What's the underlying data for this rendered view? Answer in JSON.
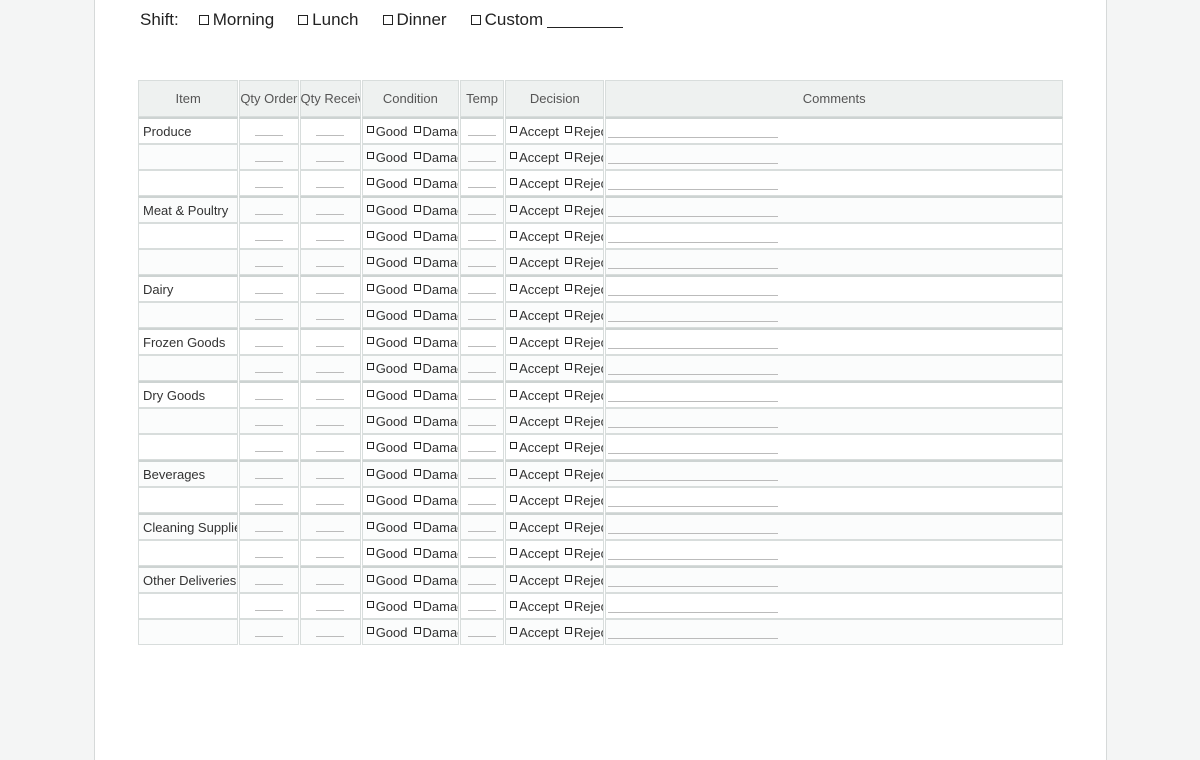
{
  "shift": {
    "label": "Shift:",
    "options": [
      "Morning",
      "Lunch",
      "Dinner",
      "Custom"
    ]
  },
  "table": {
    "headers": [
      "Item",
      "Qty Ordered",
      "Qty Received",
      "Condition",
      "Temp",
      "Decision",
      "Comments"
    ],
    "condition_options": [
      "Good",
      "Damaged"
    ],
    "decision_options": [
      "Accept",
      "Reject"
    ],
    "rows": [
      {
        "item": "Produce",
        "group_start": true
      },
      {
        "item": "",
        "group_start": false
      },
      {
        "item": "",
        "group_start": false
      },
      {
        "item": "Meat & Poultry",
        "group_start": true
      },
      {
        "item": "",
        "group_start": false
      },
      {
        "item": "",
        "group_start": false
      },
      {
        "item": "Dairy",
        "group_start": true
      },
      {
        "item": "",
        "group_start": false
      },
      {
        "item": "Frozen Goods",
        "group_start": true
      },
      {
        "item": "",
        "group_start": false
      },
      {
        "item": "Dry Goods",
        "group_start": true
      },
      {
        "item": "",
        "group_start": false
      },
      {
        "item": "",
        "group_start": false
      },
      {
        "item": "Beverages",
        "group_start": true
      },
      {
        "item": "",
        "group_start": false
      },
      {
        "item": "Cleaning Supplies",
        "group_start": true
      },
      {
        "item": "",
        "group_start": false
      },
      {
        "item": "Other Deliveries",
        "group_start": true
      },
      {
        "item": "",
        "group_start": false
      },
      {
        "item": "",
        "group_start": false
      }
    ]
  }
}
